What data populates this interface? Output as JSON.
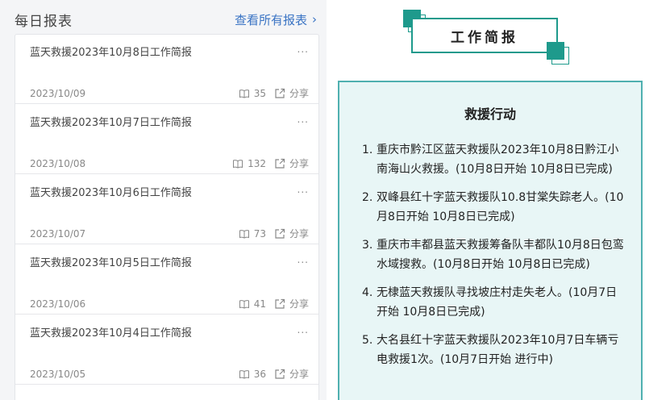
{
  "left": {
    "title": "每日报表",
    "view_all": "查看所有报表",
    "items": [
      {
        "title": "蓝天救援2023年10月8日工作简报",
        "more": "...",
        "date": "2023/10/09",
        "views": "35",
        "share": "分享"
      },
      {
        "title": "蓝天救援2023年10月7日工作简报",
        "more": "...",
        "date": "2023/10/08",
        "views": "132",
        "share": "分享"
      },
      {
        "title": "蓝天救援2023年10月6日工作简报",
        "more": "...",
        "date": "2023/10/07",
        "views": "73",
        "share": "分享"
      },
      {
        "title": "蓝天救援2023年10月5日工作简报",
        "more": "...",
        "date": "2023/10/06",
        "views": "41",
        "share": "分享"
      },
      {
        "title": "蓝天救援2023年10月4日工作简报",
        "more": "...",
        "date": "2023/10/05",
        "views": "36",
        "share": "分享"
      }
    ]
  },
  "right": {
    "badge": "工作简报",
    "card_title": "救援行动",
    "entries": [
      {
        "num": "1.",
        "text": "重庆市黔江区蓝天救援队2023年10月8日黔江小南海山火救援。(10月8日开始 10月8日已完成)"
      },
      {
        "num": "2.",
        "text": "双峰县红十字蓝天救援队10.8甘棠失踪老人。(10月8日开始 10月8日已完成)"
      },
      {
        "num": "3.",
        "text": "重庆市丰都县蓝天救援筹备队丰都队10月8日包鸾水域搜救。(10月8日开始 10月8日已完成)"
      },
      {
        "num": "4.",
        "text": "无棣蓝天救援队寻找坡庄村走失老人。(10月7日开始 10月8日已完成)"
      },
      {
        "num": "5.",
        "text": "大名县红十字蓝天救援队2023年10月7日车辆亏电救援1次。(10月7日开始 进行中)"
      }
    ]
  },
  "colors": {
    "accent": "#1e9a8c",
    "card_border": "#4fb0b0",
    "card_bg": "#e8f6f6",
    "link": "#3a74c4"
  }
}
